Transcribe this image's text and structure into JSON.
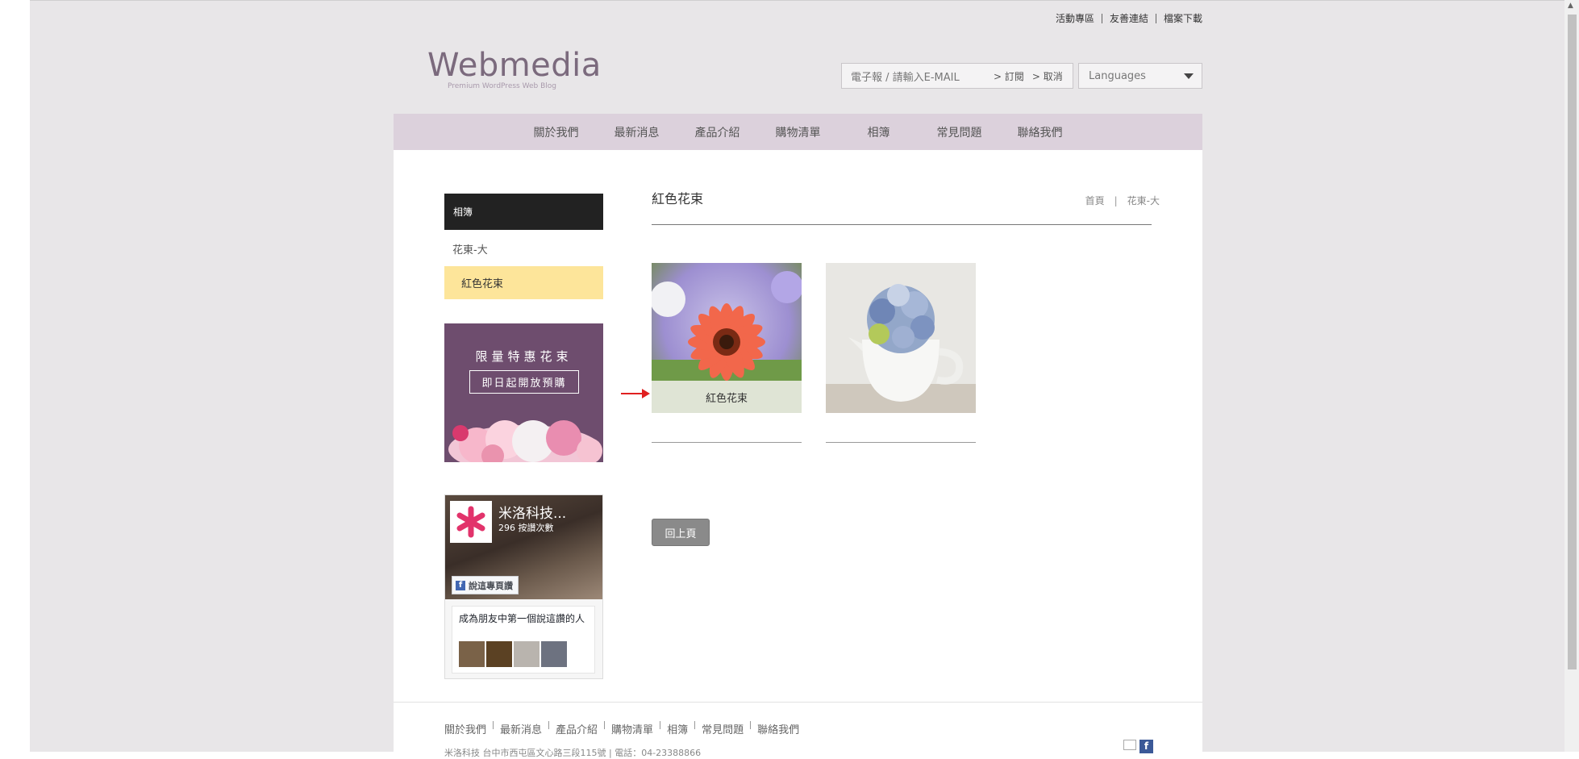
{
  "top_links": [
    "活動專區",
    "友善連結",
    "檔案下載"
  ],
  "logo": {
    "title": "Webmedia",
    "subtitle": "Premium WordPress Web Blog"
  },
  "subscribe": {
    "placeholder": "電子報 / 請輸入E-MAIL",
    "subscribe_label": "> 訂閱",
    "cancel_label": "> 取消"
  },
  "language": {
    "selected": "Languages"
  },
  "nav": [
    "關於我們",
    "最新消息",
    "產品介紹",
    "購物清單",
    "相簿",
    "常見問題",
    "聯絡我們"
  ],
  "sidebar": {
    "heading": "相簿",
    "items": [
      {
        "label": "花東-大",
        "active": false
      },
      {
        "label": "紅色花束",
        "active": true
      }
    ]
  },
  "banner": {
    "line1": "限量特惠花束",
    "line2": "即日起開放預購"
  },
  "facebook": {
    "page_name": "米洛科技...",
    "likes": "296 按讚次數",
    "like_button": "說這專頁讚",
    "friends_text": "成為朋友中第一個說這讚的人",
    "fb_letter": "f"
  },
  "main": {
    "title": "紅色花束",
    "breadcrumb": {
      "home": "首頁",
      "separator": "|",
      "current": "花東-大"
    },
    "photos": [
      {
        "caption": "紅色花束",
        "subject": "orange gerbera daisy"
      },
      {
        "caption": "",
        "subject": "blue hydrangea in white pitcher"
      }
    ],
    "back_button": "回上頁"
  },
  "footer": {
    "nav": [
      "關於我們",
      "最新消息",
      "產品介紹",
      "購物清單",
      "相簿",
      "常見問題",
      "聯絡我們"
    ],
    "address": "米洛科技 台中市西屯區文心路三段115號 | 電話：04-23388866"
  },
  "colors": {
    "nav_bg": "#dcd1dc",
    "active_item": "#fde59a",
    "sidebar_head": "#222222",
    "logo": "#7b6a7d",
    "arrow": "#e02020"
  }
}
